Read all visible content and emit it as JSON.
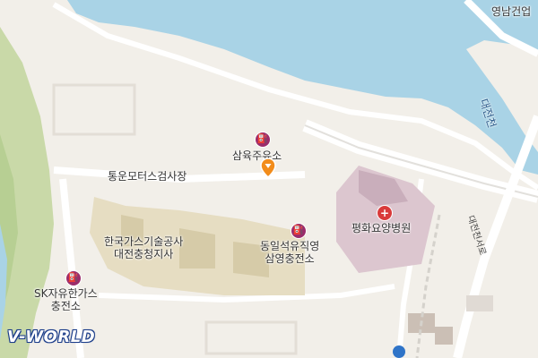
{
  "map": {
    "labels": {
      "top_right_company": "영남건업",
      "river": "대전천",
      "road": "대전천서로",
      "gas_station": "삼육주유소",
      "inspection": "통운모터스검사장",
      "gas_corp": "한국가스기술공사\n대전충청지사",
      "dongil": "동일석유직영\n삼영충전소",
      "hospital": "평화요양병원",
      "sk_station": "SK자유한가스\n충전소"
    },
    "logo": "V-WORLD",
    "colors": {
      "water": "#a9d3e6",
      "green": "#c9d9a8",
      "facility": "#e6ddc2",
      "hospital_zone": "#dcc6cf",
      "road": "#ffffff",
      "background": "#f2efe9",
      "poi": "#9b2c6b",
      "hospital_icon": "#d93a3a",
      "pin": "#f28c1b"
    },
    "icons": {
      "fuel": "fuel-pump-icon",
      "hospital": "hospital-cross-icon",
      "marker": "location-pin-icon"
    }
  }
}
